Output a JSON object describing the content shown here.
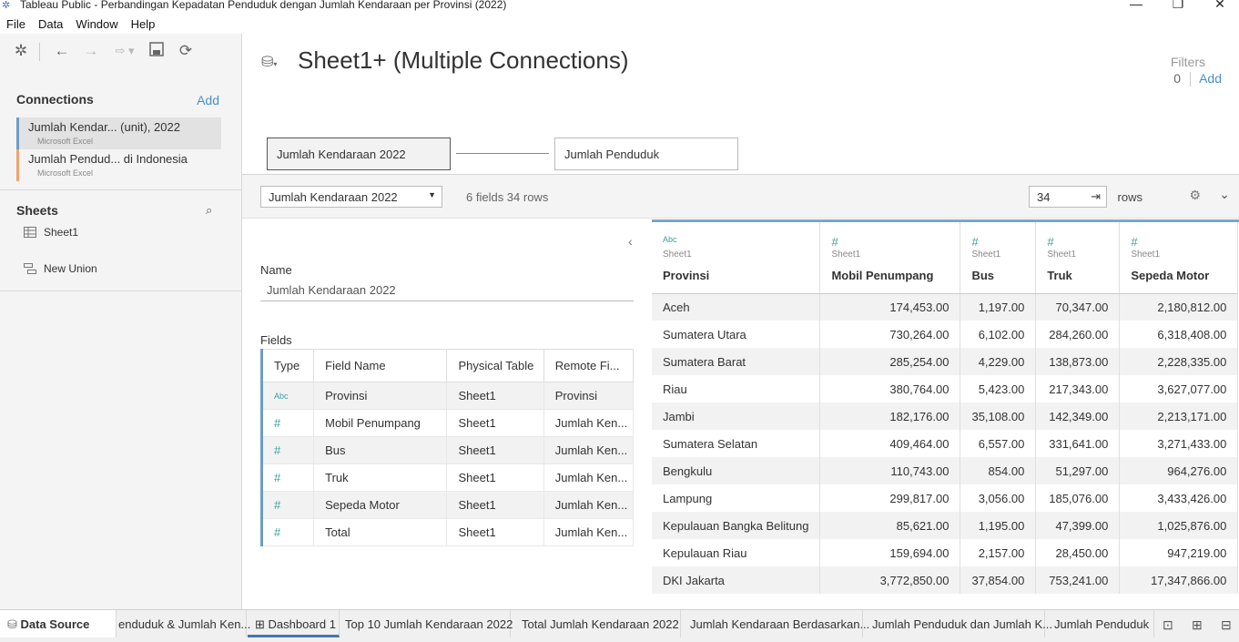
{
  "window": {
    "title": "Tableau Public - Perbandingan Kepadatan Penduduk dengan Jumlah Kendaraan per Provinsi (2022)",
    "controls": [
      "—",
      "❐",
      "✕"
    ]
  },
  "menu": [
    "File",
    "Data",
    "Window",
    "Help"
  ],
  "sidebar": {
    "connections_title": "Connections",
    "connections_add": "Add",
    "connections": [
      {
        "name": "Jumlah Kendar... (unit), 2022",
        "type": "Microsoft Excel",
        "color": "#6d9cc7"
      },
      {
        "name": "Jumlah Pendud... di Indonesia",
        "type": "Microsoft Excel",
        "color": "#f0a46c"
      }
    ],
    "sheets_title": "Sheets",
    "sheets": [
      "Sheet1"
    ],
    "new_union": "New Union"
  },
  "header": {
    "title": "Sheet1+ (Multiple Connections)",
    "filters_label": "Filters",
    "filters_count": "0",
    "filters_add": "Add"
  },
  "canvas": {
    "left_table": "Jumlah Kendaraan 2022",
    "right_table": "Jumlah Penduduk"
  },
  "gridbar": {
    "table_select": "Jumlah Kendaraan 2022",
    "field_info": "6 fields 34 rows",
    "rows_value": "34",
    "rows_label": "rows"
  },
  "metadata": {
    "name_label": "Name",
    "name_value": "Jumlah Kendaraan 2022",
    "fields_label": "Fields",
    "columns": [
      "Type",
      "Field Name",
      "Physical Table",
      "Remote Fi..."
    ],
    "rows": [
      {
        "type": "Abc",
        "field": "Provinsi",
        "table": "Sheet1",
        "remote": "Provinsi"
      },
      {
        "type": "#",
        "field": "Mobil Penumpang",
        "table": "Sheet1",
        "remote": "Jumlah Ken..."
      },
      {
        "type": "#",
        "field": "Bus",
        "table": "Sheet1",
        "remote": "Jumlah Ken..."
      },
      {
        "type": "#",
        "field": "Truk",
        "table": "Sheet1",
        "remote": "Jumlah Ken..."
      },
      {
        "type": "#",
        "field": "Sepeda Motor",
        "table": "Sheet1",
        "remote": "Jumlah Ken..."
      },
      {
        "type": "#",
        "field": "Total",
        "table": "Sheet1",
        "remote": "Jumlah Ken..."
      }
    ]
  },
  "grid": {
    "columns": [
      {
        "type": "Abc",
        "source": "Sheet1",
        "name": "Provinsi"
      },
      {
        "type": "#",
        "source": "Sheet1",
        "name": "Mobil Penumpang"
      },
      {
        "type": "#",
        "source": "Sheet1",
        "name": "Bus"
      },
      {
        "type": "#",
        "source": "Sheet1",
        "name": "Truk"
      },
      {
        "type": "#",
        "source": "Sheet1",
        "name": "Sepeda Motor"
      }
    ],
    "rows": [
      [
        "Aceh",
        "174,453.00",
        "1,197.00",
        "70,347.00",
        "2,180,812.00"
      ],
      [
        "Sumatera Utara",
        "730,264.00",
        "6,102.00",
        "284,260.00",
        "6,318,408.00"
      ],
      [
        "Sumatera Barat",
        "285,254.00",
        "4,229.00",
        "138,873.00",
        "2,228,335.00"
      ],
      [
        "Riau",
        "380,764.00",
        "5,423.00",
        "217,343.00",
        "3,627,077.00"
      ],
      [
        "Jambi",
        "182,176.00",
        "35,108.00",
        "142,349.00",
        "2,213,171.00"
      ],
      [
        "Sumatera Selatan",
        "409,464.00",
        "6,557.00",
        "331,641.00",
        "3,271,433.00"
      ],
      [
        "Bengkulu",
        "110,743.00",
        "854.00",
        "51,297.00",
        "964,276.00"
      ],
      [
        "Lampung",
        "299,817.00",
        "3,056.00",
        "185,076.00",
        "3,433,426.00"
      ],
      [
        "Kepulauan Bangka Belitung",
        "85,621.00",
        "1,195.00",
        "47,399.00",
        "1,025,876.00"
      ],
      [
        "Kepulauan Riau",
        "159,694.00",
        "2,157.00",
        "28,450.00",
        "947,219.00"
      ],
      [
        "DKI Jakarta",
        "3,772,850.00",
        "37,854.00",
        "753,241.00",
        "17,347,866.00"
      ]
    ]
  },
  "tabs": {
    "data_source": "Data Source",
    "items": [
      "enduduk & Jumlah Ken...",
      "Dashboard 1",
      "Top 10 Jumlah Kendaraan 2022",
      "Total Jumlah Kendaraan 2022",
      "Jumlah Kendaraan Berdasarkan...",
      "Jumlah Penduduk dan Jumlah K...",
      "Jumlah Penduduk"
    ],
    "active_index": 1
  }
}
